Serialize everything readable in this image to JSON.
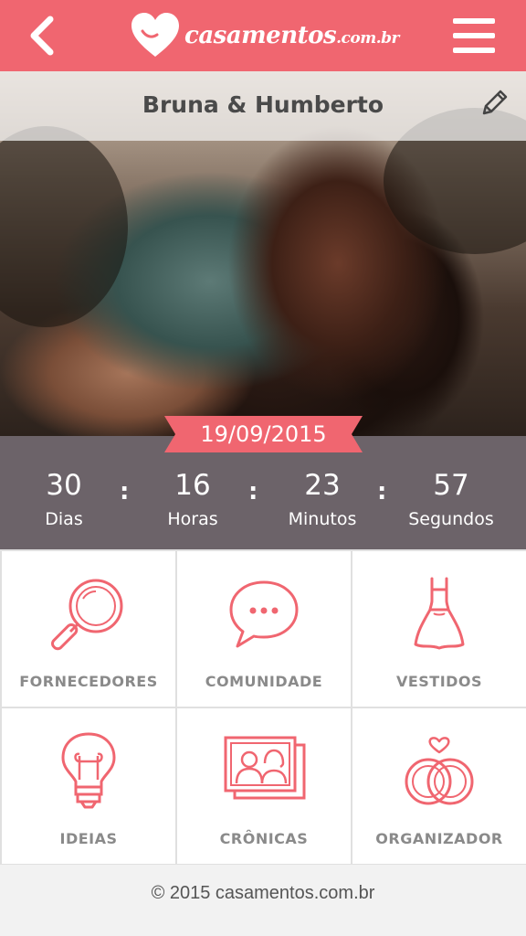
{
  "header": {
    "back_icon": "chevron-left-icon",
    "logo_name": "casamentos",
    "logo_domain": ".com.br",
    "menu_icon": "hamburger-menu-icon",
    "background_color": "#f06670"
  },
  "profile": {
    "couple_name": "Bruna & Humberto",
    "edit_icon": "pencil-icon"
  },
  "countdown": {
    "date": "19/09/2015",
    "units": [
      {
        "value": "30",
        "label": "Dias"
      },
      {
        "value": "16",
        "label": "Horas"
      },
      {
        "value": "23",
        "label": "Minutos"
      },
      {
        "value": "57",
        "label": "Segundos"
      }
    ],
    "separator": ":"
  },
  "tiles": [
    {
      "label": "FORNECEDORES",
      "icon": "magnifier-icon"
    },
    {
      "label": "COMUNIDADE",
      "icon": "chat-bubble-icon"
    },
    {
      "label": "VESTIDOS",
      "icon": "dress-icon"
    },
    {
      "label": "IDEIAS",
      "icon": "lightbulb-icon"
    },
    {
      "label": "CRÔNICAS",
      "icon": "photo-album-icon"
    },
    {
      "label": "ORGANIZADOR",
      "icon": "rings-icon"
    }
  ],
  "footer": {
    "copyright": "© 2015 casamentos.com.br"
  },
  "colors": {
    "accent": "#f06670",
    "countdown_bg": "#6c6369",
    "tile_label": "#8a8a8a"
  }
}
